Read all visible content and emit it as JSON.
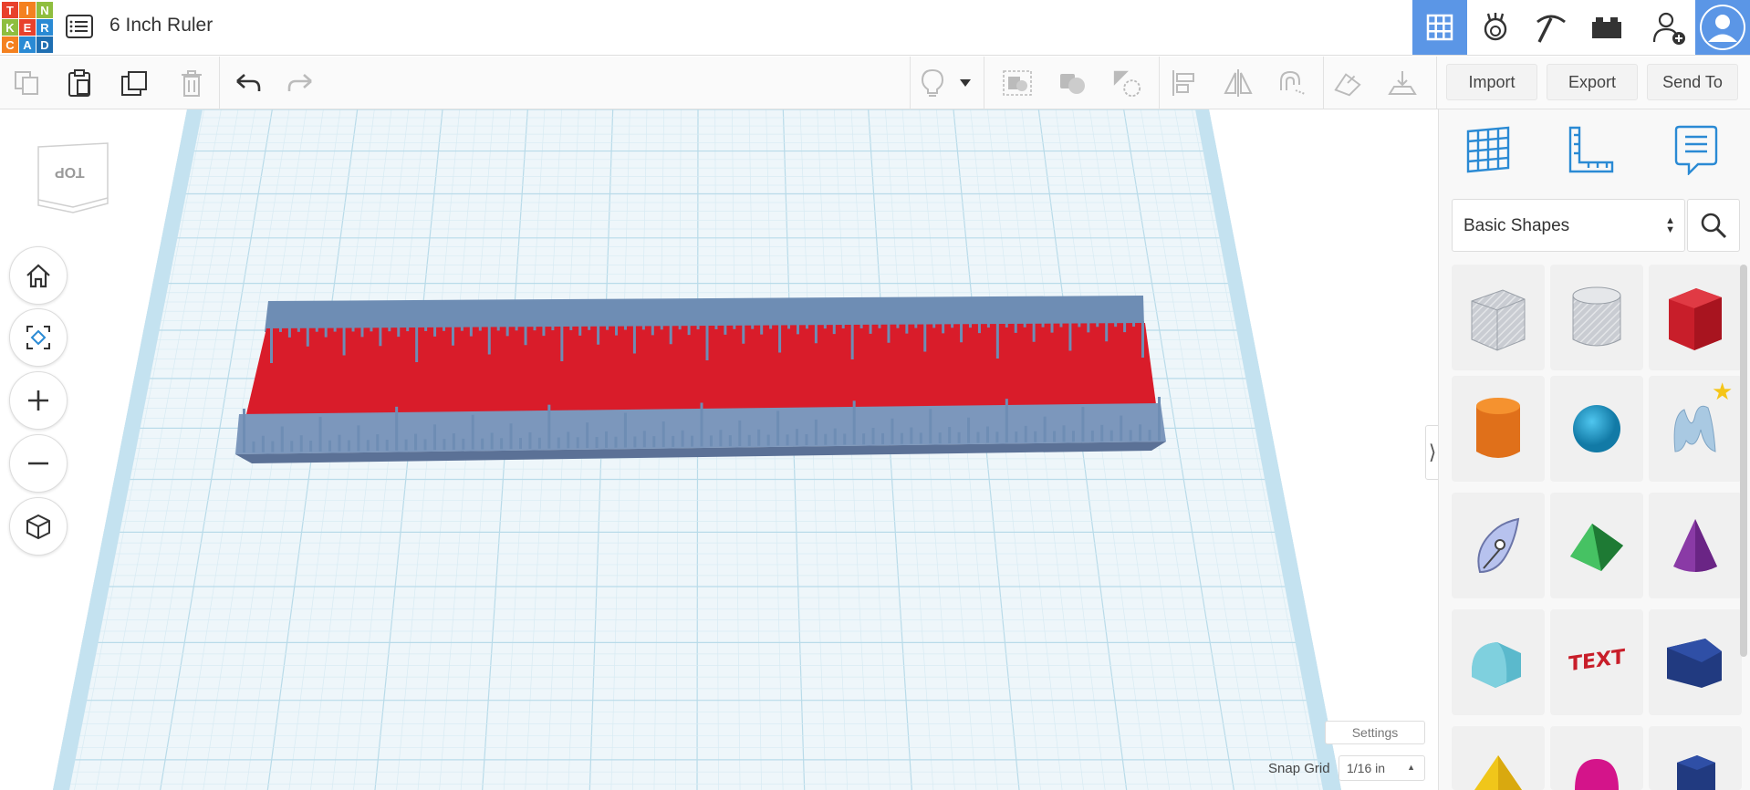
{
  "app": {
    "logo_letters": [
      "T",
      "I",
      "N",
      "K",
      "E",
      "R",
      "C",
      "A",
      "D"
    ],
    "logo_colors": [
      "#e8412c",
      "#f48120",
      "#8fbe3f",
      "#8fbe3f",
      "#e8412c",
      "#2a8ad4",
      "#f48120",
      "#2a8ad4",
      "#1f6fb2"
    ],
    "title": "6 Inch Ruler"
  },
  "top_nav": {
    "icons": [
      "3d-design-icon",
      "circuits-icon",
      "minecraft-icon",
      "lego-bricks-icon",
      "invite-user-icon",
      "user-avatar-icon"
    ],
    "active_color": "#5b96e6"
  },
  "toolbar": {
    "import_label": "Import",
    "export_label": "Export",
    "send_to_label": "Send To"
  },
  "view_cube": {
    "face_label": "TOP"
  },
  "side_panel": {
    "shape_category": "Basic Shapes",
    "shapes": [
      {
        "name": "box-hole"
      },
      {
        "name": "cylinder-hole"
      },
      {
        "name": "box"
      },
      {
        "name": "cylinder"
      },
      {
        "name": "sphere"
      },
      {
        "name": "scribble"
      },
      {
        "name": "paraboloid-shape"
      },
      {
        "name": "roof"
      },
      {
        "name": "cone"
      },
      {
        "name": "round-roof"
      },
      {
        "name": "text"
      },
      {
        "name": "wedge"
      },
      {
        "name": "pyramid"
      },
      {
        "name": "half-sphere"
      },
      {
        "name": "polygon"
      }
    ]
  },
  "workplane": {
    "settings_label": "Settings",
    "snap_grid_label": "Snap Grid",
    "snap_grid_value": "1/16 in",
    "ruler_color": "#d91c2a",
    "ruler_tick_color": "#6e8db4"
  }
}
